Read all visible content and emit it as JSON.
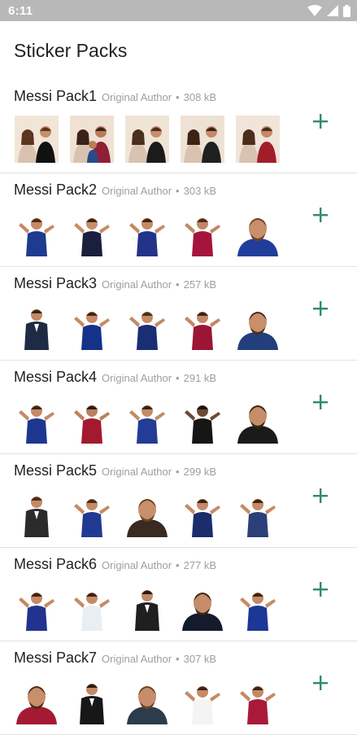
{
  "status_bar": {
    "time": "6:11"
  },
  "app_bar": {
    "title": "Sticker Packs"
  },
  "colors": {
    "accent": "#2e8b6e",
    "status_bar": "#b8b8b8"
  },
  "packs": [
    {
      "name": "Messi Pack1",
      "author": "Original Author",
      "separator": "•",
      "size": "308 kB",
      "stickers": [
        {
          "icon": "couple-sticker-icon",
          "bg": "#f1e5d8",
          "shirt": "#111111",
          "skin": "#c98e68",
          "hair": "#5a3520"
        },
        {
          "icon": "family-sticker-icon",
          "bg": "#efe1d4",
          "shirt": "#8f1f35",
          "skin": "#b97c58",
          "hair": "#3a2418"
        },
        {
          "icon": "couple-sticker-icon",
          "bg": "#f0e4d6",
          "shirt": "#1b1b1b",
          "skin": "#c88e6b",
          "hair": "#4a2f1e"
        },
        {
          "icon": "couple-sticker-icon",
          "bg": "#eee2d4",
          "shirt": "#202020",
          "skin": "#c38a66",
          "hair": "#3b2416"
        },
        {
          "icon": "couple-sticker-icon",
          "bg": "#f1e4d9",
          "shirt": "#a11d2a",
          "skin": "#c4896a",
          "hair": "#4c2c1b"
        }
      ]
    },
    {
      "name": "Messi Pack2",
      "author": "Original Author",
      "separator": "•",
      "size": "303 kB",
      "stickers": [
        {
          "icon": "player-sticker-icon",
          "bg": "#ffffff",
          "shirt": "#1d3c8f",
          "skin": "#c48a66",
          "hair": "#4a2c18"
        },
        {
          "icon": "player-sticker-icon",
          "bg": "#ffffff",
          "shirt": "#1a1f3d",
          "skin": "#c68d68",
          "hair": "#3c2415"
        },
        {
          "icon": "player-sticker-icon",
          "bg": "#ffffff",
          "shirt": "#23338a",
          "skin": "#c48a66",
          "hair": "#3f2614"
        },
        {
          "icon": "player-sticker-icon",
          "bg": "#ffffff",
          "shirt": "#a5153b",
          "skin": "#c18866",
          "hair": "#4b2d1a"
        },
        {
          "icon": "portrait-sticker-icon",
          "bg": "#ffffff",
          "shirt": "#203d9c",
          "skin": "#c78f6a",
          "hair": "#6b4426"
        }
      ]
    },
    {
      "name": "Messi Pack3",
      "author": "Original Author",
      "separator": "•",
      "size": "257 kB",
      "stickers": [
        {
          "icon": "suit-sticker-icon",
          "bg": "#ffffff",
          "shirt": "#1f2a44",
          "skin": "#c28a68",
          "hair": "#3a2414"
        },
        {
          "icon": "player-sticker-icon",
          "bg": "#ffffff",
          "shirt": "#16318a",
          "skin": "#c48b66",
          "hair": "#3e2514"
        },
        {
          "icon": "player-sticker-icon",
          "bg": "#ffffff",
          "shirt": "#1a2e74",
          "skin": "#c38a66",
          "hair": "#4a2d18"
        },
        {
          "icon": "player-sticker-icon",
          "bg": "#ffffff",
          "shirt": "#9c1534",
          "skin": "#c08765",
          "hair": "#3a2213"
        },
        {
          "icon": "portrait-sticker-icon",
          "bg": "#ffffff",
          "shirt": "#233e7c",
          "skin": "#c78f6a",
          "hair": "#4b2e1a"
        }
      ]
    },
    {
      "name": "Messi Pack4",
      "author": "Original Author",
      "separator": "•",
      "size": "291 kB",
      "stickers": [
        {
          "icon": "player-sticker-icon",
          "bg": "#ffffff",
          "shirt": "#1d3791",
          "skin": "#c48a66",
          "hair": "#3e2414"
        },
        {
          "icon": "player-sticker-icon",
          "bg": "#ffffff",
          "shirt": "#a31a2e",
          "skin": "#b9825f",
          "hair": "#2f1c10"
        },
        {
          "icon": "player-sticker-icon",
          "bg": "#ffffff",
          "shirt": "#233c96",
          "skin": "#c48b66",
          "hair": "#3b2314"
        },
        {
          "icon": "player-sticker-icon",
          "bg": "#ffffff",
          "shirt": "#161616",
          "skin": "#6d4a35",
          "hair": "#1d130c"
        },
        {
          "icon": "portrait-sticker-icon",
          "bg": "#ffffff",
          "shirt": "#1a1a1a",
          "skin": "#c58d69",
          "hair": "#3a2414"
        }
      ]
    },
    {
      "name": "Messi Pack5",
      "author": "Original Author",
      "separator": "•",
      "size": "299 kB",
      "stickers": [
        {
          "icon": "suit-sticker-icon",
          "bg": "#ffffff",
          "shirt": "#2b2b2b",
          "skin": "#c48a66",
          "hair": "#4a2e1a"
        },
        {
          "icon": "player-sticker-icon",
          "bg": "#ffffff",
          "shirt": "#203a93",
          "skin": "#c48a66",
          "hair": "#4a2c18"
        },
        {
          "icon": "portrait-sticker-icon",
          "bg": "#ffffff",
          "shirt": "#3a2a22",
          "skin": "#c78f6a",
          "hair": "#6b4426"
        },
        {
          "icon": "player-sticker-icon",
          "bg": "#ffffff",
          "shirt": "#1b2d6c",
          "skin": "#c38a66",
          "hair": "#3a2213"
        },
        {
          "icon": "player-sticker-icon",
          "bg": "#ffffff",
          "shirt": "#2c3f78",
          "skin": "#c48b66",
          "hair": "#3e2514"
        }
      ]
    },
    {
      "name": "Messi Pack6",
      "author": "Original Author",
      "separator": "•",
      "size": "277 kB",
      "stickers": [
        {
          "icon": "player-sticker-icon",
          "bg": "#ffffff",
          "shirt": "#22338f",
          "skin": "#c48a66",
          "hair": "#3e2414"
        },
        {
          "icon": "player-sticker-icon",
          "bg": "#ffffff",
          "shirt": "#e9eef5",
          "skin": "#c48b66",
          "hair": "#3b2314"
        },
        {
          "icon": "suit-sticker-icon",
          "bg": "#ffffff",
          "shirt": "#1f1f1f",
          "skin": "#c28a68",
          "hair": "#2a1a10"
        },
        {
          "icon": "portrait-sticker-icon",
          "bg": "#ffffff",
          "shirt": "#141b2c",
          "skin": "#c58d69",
          "hair": "#3a2414"
        },
        {
          "icon": "player-sticker-icon",
          "bg": "#ffffff",
          "shirt": "#1c3796",
          "skin": "#c48a66",
          "hair": "#3e2414"
        }
      ]
    },
    {
      "name": "Messi Pack7",
      "author": "Original Author",
      "separator": "•",
      "size": "307 kB",
      "stickers": [
        {
          "icon": "portrait-sticker-icon",
          "bg": "#ffffff",
          "shirt": "#a51a33",
          "skin": "#c78f6a",
          "hair": "#4b2e1a"
        },
        {
          "icon": "suit-sticker-icon",
          "bg": "#ffffff",
          "shirt": "#171717",
          "skin": "#c28a68",
          "hair": "#2d1b10"
        },
        {
          "icon": "portrait-sticker-icon",
          "bg": "#ffffff",
          "shirt": "#2c3c4a",
          "skin": "#c58d69",
          "hair": "#6b4426"
        },
        {
          "icon": "player-sticker-icon",
          "bg": "#ffffff",
          "shirt": "#f4f4f4",
          "skin": "#c48b66",
          "hair": "#3b2314"
        },
        {
          "icon": "player-sticker-icon",
          "bg": "#ffffff",
          "shirt": "#a8193a",
          "skin": "#c48a66",
          "hair": "#3e2414"
        }
      ]
    }
  ]
}
